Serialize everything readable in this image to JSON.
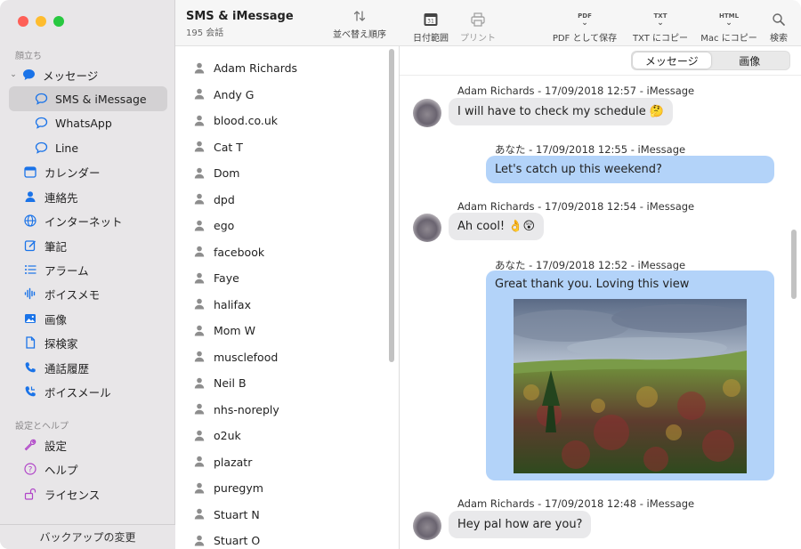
{
  "sidebar": {
    "section1": "顔立ち",
    "messages_group": "メッセージ",
    "items": [
      {
        "label": "SMS & iMessage",
        "icon": "chat-bubble-icon"
      },
      {
        "label": "WhatsApp",
        "icon": "chat-bubble-icon"
      },
      {
        "label": "Line",
        "icon": "chat-bubble-icon"
      },
      {
        "label": "カレンダー",
        "icon": "calendar-icon"
      },
      {
        "label": "連絡先",
        "icon": "person-icon"
      },
      {
        "label": "インターネット",
        "icon": "globe-icon"
      },
      {
        "label": "筆記",
        "icon": "note-icon"
      },
      {
        "label": "アラーム",
        "icon": "list-icon"
      },
      {
        "label": "ボイスメモ",
        "icon": "waveform-icon"
      },
      {
        "label": "画像",
        "icon": "photo-icon"
      },
      {
        "label": "探検家",
        "icon": "document-icon"
      },
      {
        "label": "通話履歴",
        "icon": "phone-icon"
      },
      {
        "label": "ボイスメール",
        "icon": "voicemail-icon"
      }
    ],
    "section2": "設定とヘルプ",
    "settings_items": [
      {
        "label": "設定",
        "icon": "wrench-icon"
      },
      {
        "label": "ヘルプ",
        "icon": "question-icon"
      },
      {
        "label": "ライセンス",
        "icon": "unlock-icon"
      }
    ],
    "footer": "バックアップの変更"
  },
  "contacts_pane": {
    "title": "SMS & iMessage",
    "count": "195 会話",
    "sort_label": "並べ替え順序",
    "contacts": [
      "Adam Richards",
      "Andy G",
      "blood.co.uk",
      "Cat T",
      "Dom",
      "dpd",
      "ego",
      "facebook",
      "Faye",
      "halifax",
      "Mom W",
      "musclefood",
      "Neil B",
      "nhs-noreply",
      "o2uk",
      "plazatr",
      "puregym",
      "Stuart N",
      "Stuart O"
    ]
  },
  "toolbar": {
    "date_range": "日付範囲",
    "print": "プリント",
    "pdf_badge": "PDF",
    "pdf_save": "PDF として保存",
    "txt_badge": "TXT",
    "txt_copy": "TXT にコピー",
    "html_badge": "HTML",
    "mac_copy": "Mac にコピー",
    "search": "検索"
  },
  "segment": {
    "messages": "メッセージ",
    "images": "画像"
  },
  "messages": [
    {
      "meta": "Adam Richards - 17/09/2018 12:57 - iMessage",
      "text": "I will have to check my schedule 🤔",
      "direction": "in"
    },
    {
      "meta": "あなた - 17/09/2018 12:55 - iMessage",
      "text": "Let's catch up this weekend?",
      "direction": "out"
    },
    {
      "meta": "Adam Richards - 17/09/2018 12:54 - iMessage",
      "text": "Ah cool! 👌😲",
      "direction": "in"
    },
    {
      "meta": "あなた - 17/09/2018 12:52 - iMessage",
      "text": "Great thank you. Loving this view",
      "direction": "out",
      "attachment": "landscape-photo"
    },
    {
      "meta": "Adam Richards - 17/09/2018 12:48 - iMessage",
      "text": "Hey pal how are you?",
      "direction": "in"
    }
  ],
  "colors": {
    "outgoing_bubble": "#b3d3f9",
    "incoming_bubble": "#e9e9eb",
    "accent": "#1a73e8"
  }
}
